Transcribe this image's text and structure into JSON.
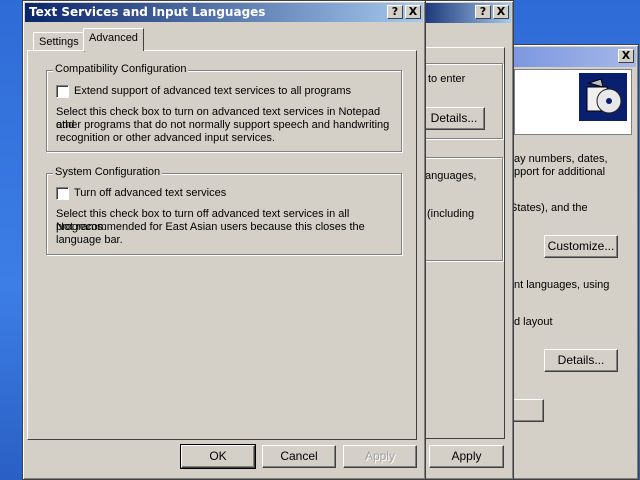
{
  "back_window": {
    "title": "",
    "close": "X",
    "icon": "cd-package-icon",
    "text_lines": [
      "ay numbers, dates,",
      "pport for additional",
      "States), and the",
      "nt languages, using",
      "d layout"
    ],
    "customize_label": "Customize...",
    "details_label": "Details..."
  },
  "mid_window": {
    "help": "?",
    "close": "X",
    "text_to_enter": "to enter",
    "details_label": "Details...",
    "languages": "anguages,",
    "including": "(including",
    "apply_label": "Apply"
  },
  "dialog": {
    "title": "Text Services and Input Languages",
    "help": "?",
    "close": "X",
    "tabs": [
      "Settings",
      "Advanced"
    ],
    "compat_group": {
      "label": "Compatibility Configuration",
      "checkbox_label": "Extend support of advanced text services to all programs",
      "description": [
        "Select this check box to turn on advanced text services in Notepad and",
        "other programs that do not normally support speech and handwriting",
        "recognition or other advanced input services."
      ]
    },
    "system_group": {
      "label": "System Configuration",
      "checkbox_label": "Turn off advanced text services",
      "description": [
        "Select this check box to turn off advanced text services in all programs.",
        "Not recommended for East Asian users because this closes the",
        "language bar."
      ]
    },
    "ok_label": "OK",
    "cancel_label": "Cancel",
    "apply_label": "Apply"
  }
}
